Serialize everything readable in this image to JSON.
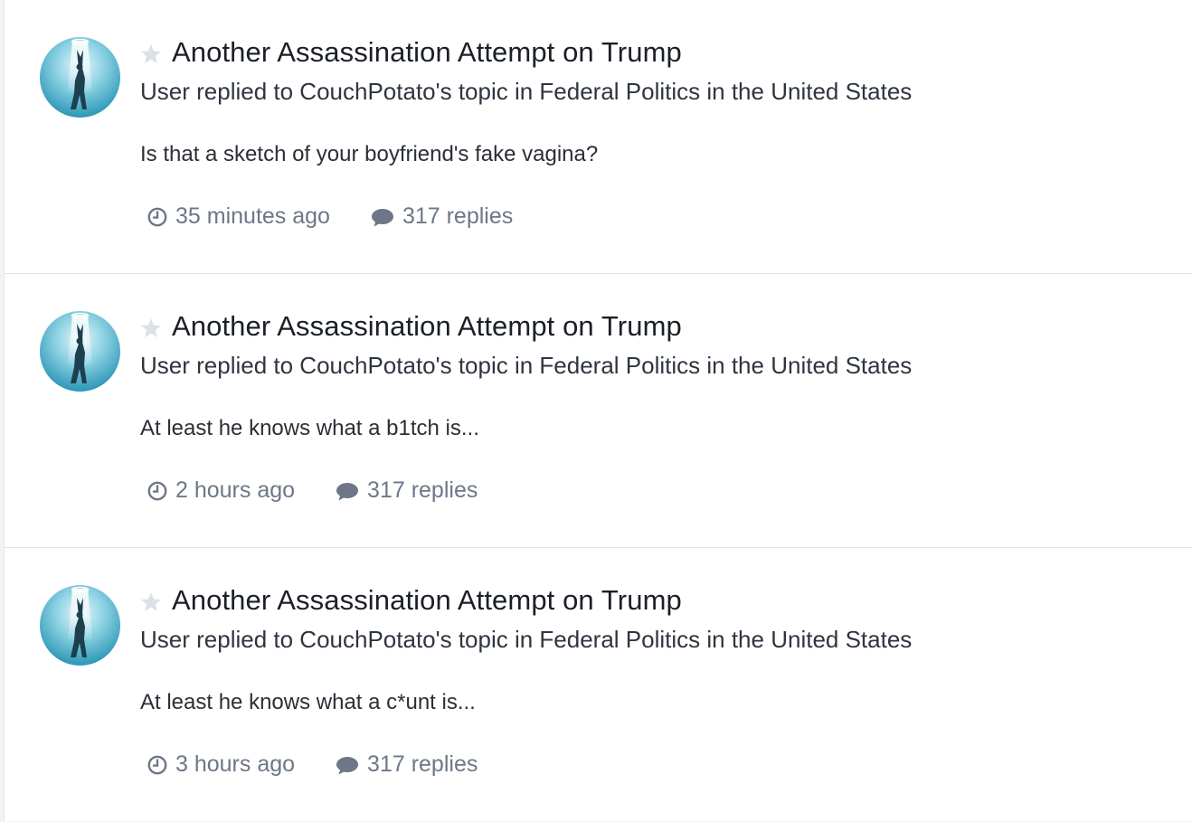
{
  "feed": {
    "items": [
      {
        "title": "Another Assassination Attempt on Trump",
        "meta": "User replied to CouchPotato's topic in Federal Politics in the United States",
        "snippet": "Is that a sketch of your boyfriend's fake vagina?",
        "time": "35 minutes ago",
        "replies": "317 replies"
      },
      {
        "title": "Another Assassination Attempt on Trump",
        "meta": "User replied to CouchPotato's topic in Federal Politics in the United States",
        "snippet": "At least he knows what a b1tch is...",
        "time": "2 hours ago",
        "replies": "317 replies"
      },
      {
        "title": "Another Assassination Attempt on Trump",
        "meta": "User replied to CouchPotato's topic in Federal Politics in the United States",
        "snippet": "At least he knows what a c*unt is...",
        "time": "3 hours ago",
        "replies": "317 replies"
      }
    ],
    "icons": {
      "star": "star-icon",
      "clock": "clock-icon",
      "comment": "comment-icon"
    },
    "colors": {
      "star": "#dbe1e9",
      "muted": "#6d7787",
      "title": "#1b1f26",
      "avatar": "#3aa6c4"
    }
  }
}
